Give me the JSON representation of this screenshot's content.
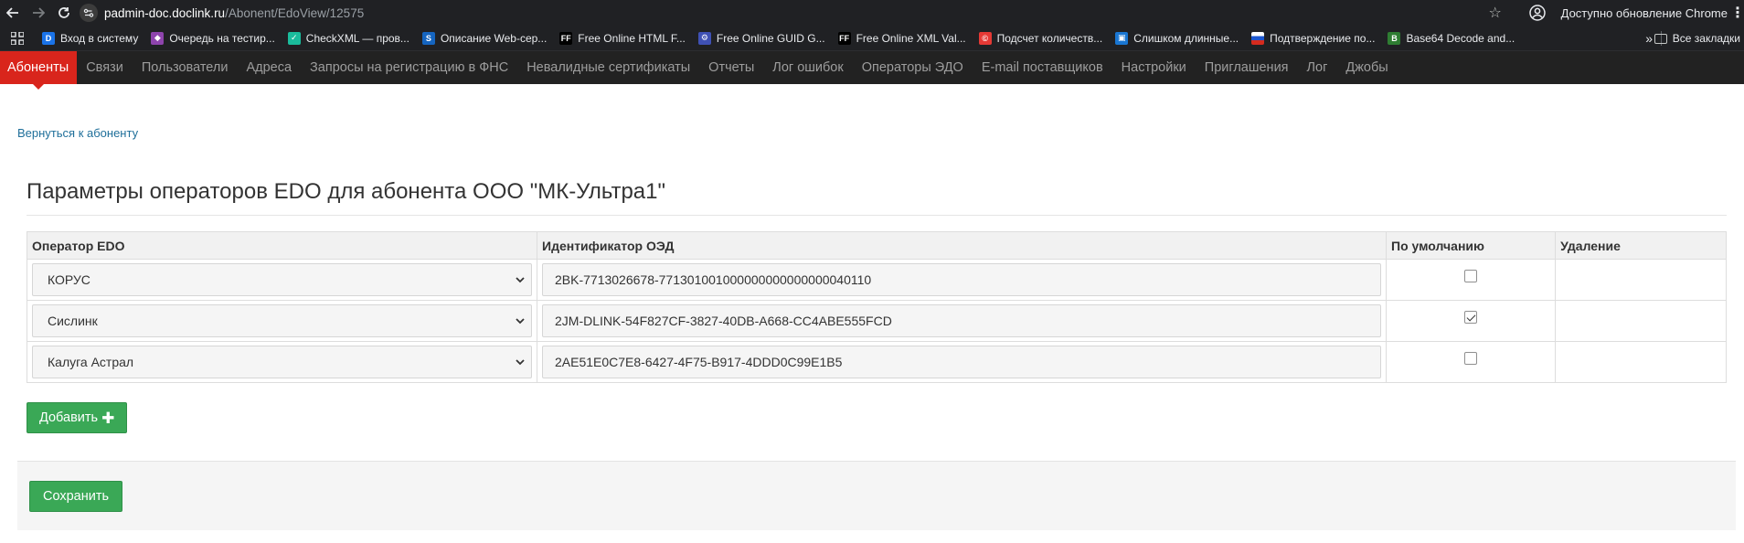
{
  "browser": {
    "url_host": "padmin-doc.doclink.ru",
    "url_path": "/Abonent/EdoView/12575",
    "update_text": "Доступно обновление Chrome"
  },
  "bookmarks": {
    "items": [
      {
        "label": "Вход в систему",
        "icon": "doclink-icon",
        "color": "#1a73e8"
      },
      {
        "label": "Очередь на тестир...",
        "icon": "visual-studio-icon",
        "color": "#8e44ad"
      },
      {
        "label": "CheckXML — пров...",
        "icon": "checkxml-icon",
        "color": "#1abc9c"
      },
      {
        "label": "Описание Web-сер...",
        "icon": "web-service-icon",
        "color": "#1565c0"
      },
      {
        "label": "Free Online HTML F...",
        "icon": "ff-icon",
        "color": "#000000"
      },
      {
        "label": "Free Online GUID G...",
        "icon": "guid-icon",
        "color": "#3f51b5"
      },
      {
        "label": "Free Online XML Val...",
        "icon": "ff-icon",
        "color": "#000000"
      },
      {
        "label": "Подсчет количеств...",
        "icon": "copyright-icon",
        "color": "#e53935"
      },
      {
        "label": "Слишком длинные...",
        "icon": "windows-icon",
        "color": "#1976d2"
      },
      {
        "label": "Подтверждение по...",
        "icon": "russia-flag-icon",
        "color": "#ffffff"
      },
      {
        "label": "Base64 Decode and...",
        "icon": "base64-icon",
        "color": "#2e7d32"
      }
    ],
    "all_bookmarks": "Все закладки"
  },
  "nav": {
    "items": [
      "Абоненты",
      "Связи",
      "Пользователи",
      "Адреса",
      "Запросы на регистрацию в ФНС",
      "Невалидные сертификаты",
      "Отчеты",
      "Лог ошибок",
      "Операторы ЭДО",
      "E-mail поставщиков",
      "Настройки",
      "Приглашения",
      "Лог",
      "Джобы"
    ],
    "active_index": 0
  },
  "page": {
    "back_link": "Вернуться к абоненту",
    "title": "Параметры операторов EDO для абонента ООО \"МК-Ультра1\""
  },
  "table": {
    "headers": {
      "operator": "Оператор EDO",
      "identifier": "Идентификатор ОЭД",
      "default": "По умолчанию",
      "delete": "Удаление"
    },
    "rows": [
      {
        "operator": "КОРУС",
        "identifier": "2BK-7713026678-771301001000000000000000040110",
        "is_default": false
      },
      {
        "operator": "Сислинк",
        "identifier": "2JM-DLINK-54F827CF-3827-40DB-A668-CC4ABE555FCD",
        "is_default": true
      },
      {
        "operator": "Калуга Астрал",
        "identifier": "2AE51E0C7E8-6427-4F75-B917-4DDD0C99E1B5",
        "is_default": false
      }
    ]
  },
  "buttons": {
    "add": "Добавить",
    "save": "Сохранить"
  },
  "colors": {
    "active_nav": "#d9251c",
    "button_green": "#3aa856",
    "link": "#1f6f9a"
  }
}
